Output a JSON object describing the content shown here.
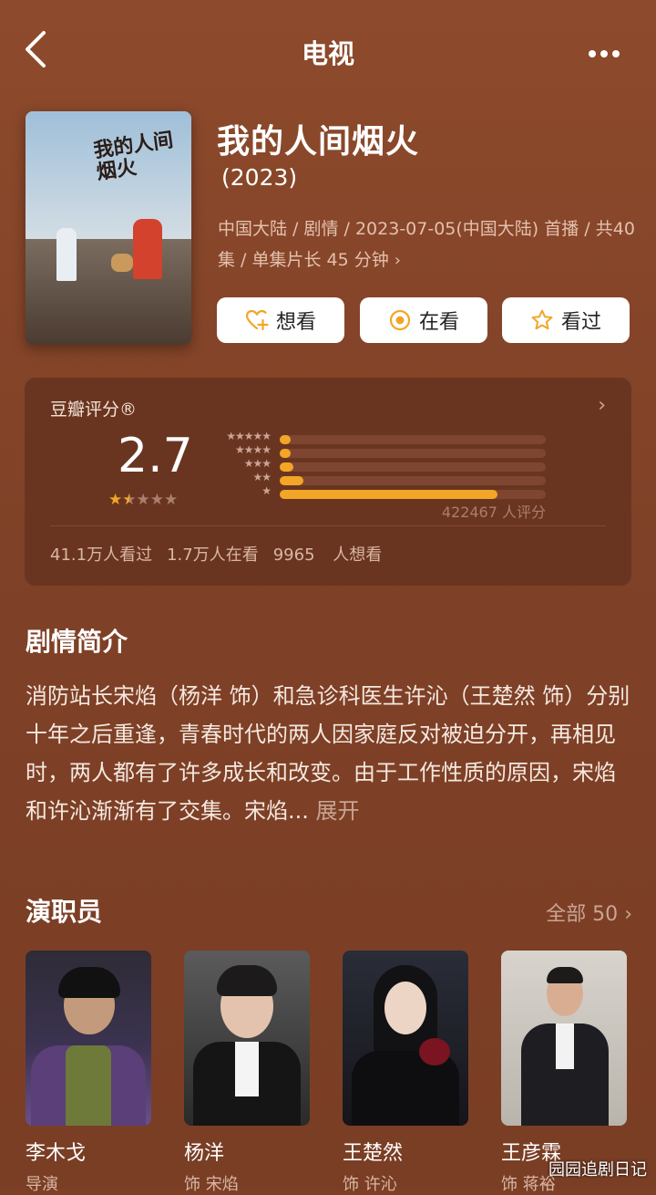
{
  "header": {
    "title": "电视"
  },
  "movie": {
    "title": "我的人间烟火",
    "year": "(2023)",
    "meta": "中国大陆 / 剧情 / 2023-07-05(中国大陆) 首播 / 共40集 / 单集片长 45 分钟",
    "poster_text": "我的人间烟火"
  },
  "actions": [
    {
      "label": "想看",
      "icon": "heart-plus-icon"
    },
    {
      "label": "在看",
      "icon": "target-icon"
    },
    {
      "label": "看过",
      "icon": "star-outline-icon"
    }
  ],
  "rating": {
    "source": "豆瓣评分®",
    "score": "2.7",
    "stars": 1.5,
    "distribution_percent": [
      4,
      4,
      5,
      9,
      82
    ],
    "count_text": "422467 人评分",
    "stats": [
      "41.1万人看过",
      "1.7万人在看",
      "9965 人想看"
    ]
  },
  "synopsis": {
    "heading": "剧情简介",
    "text": "消防站长宋焰（杨洋 饰）和急诊科医生许沁（王楚然 饰）分别十年之后重逢，青春时代的两人因家庭反对被迫分开，再相见时，两人都有了许多成长和改变。由于工作性质的原因，宋焰和许沁渐渐有了交集。宋焰...",
    "expand": "展开"
  },
  "cast": {
    "heading": "演职员",
    "all_label": "全部 50",
    "members": [
      {
        "name": "李木戈",
        "role": "导演"
      },
      {
        "name": "杨洋",
        "role": "饰 宋焰"
      },
      {
        "name": "王楚然",
        "role": "饰 许沁"
      },
      {
        "name": "王彦霖",
        "role": "饰 蒋裕"
      }
    ]
  },
  "watermark": "园园追剧日记",
  "colors": {
    "accent": "#f2a628",
    "background": "#7f4127",
    "card": "#6a3520"
  }
}
